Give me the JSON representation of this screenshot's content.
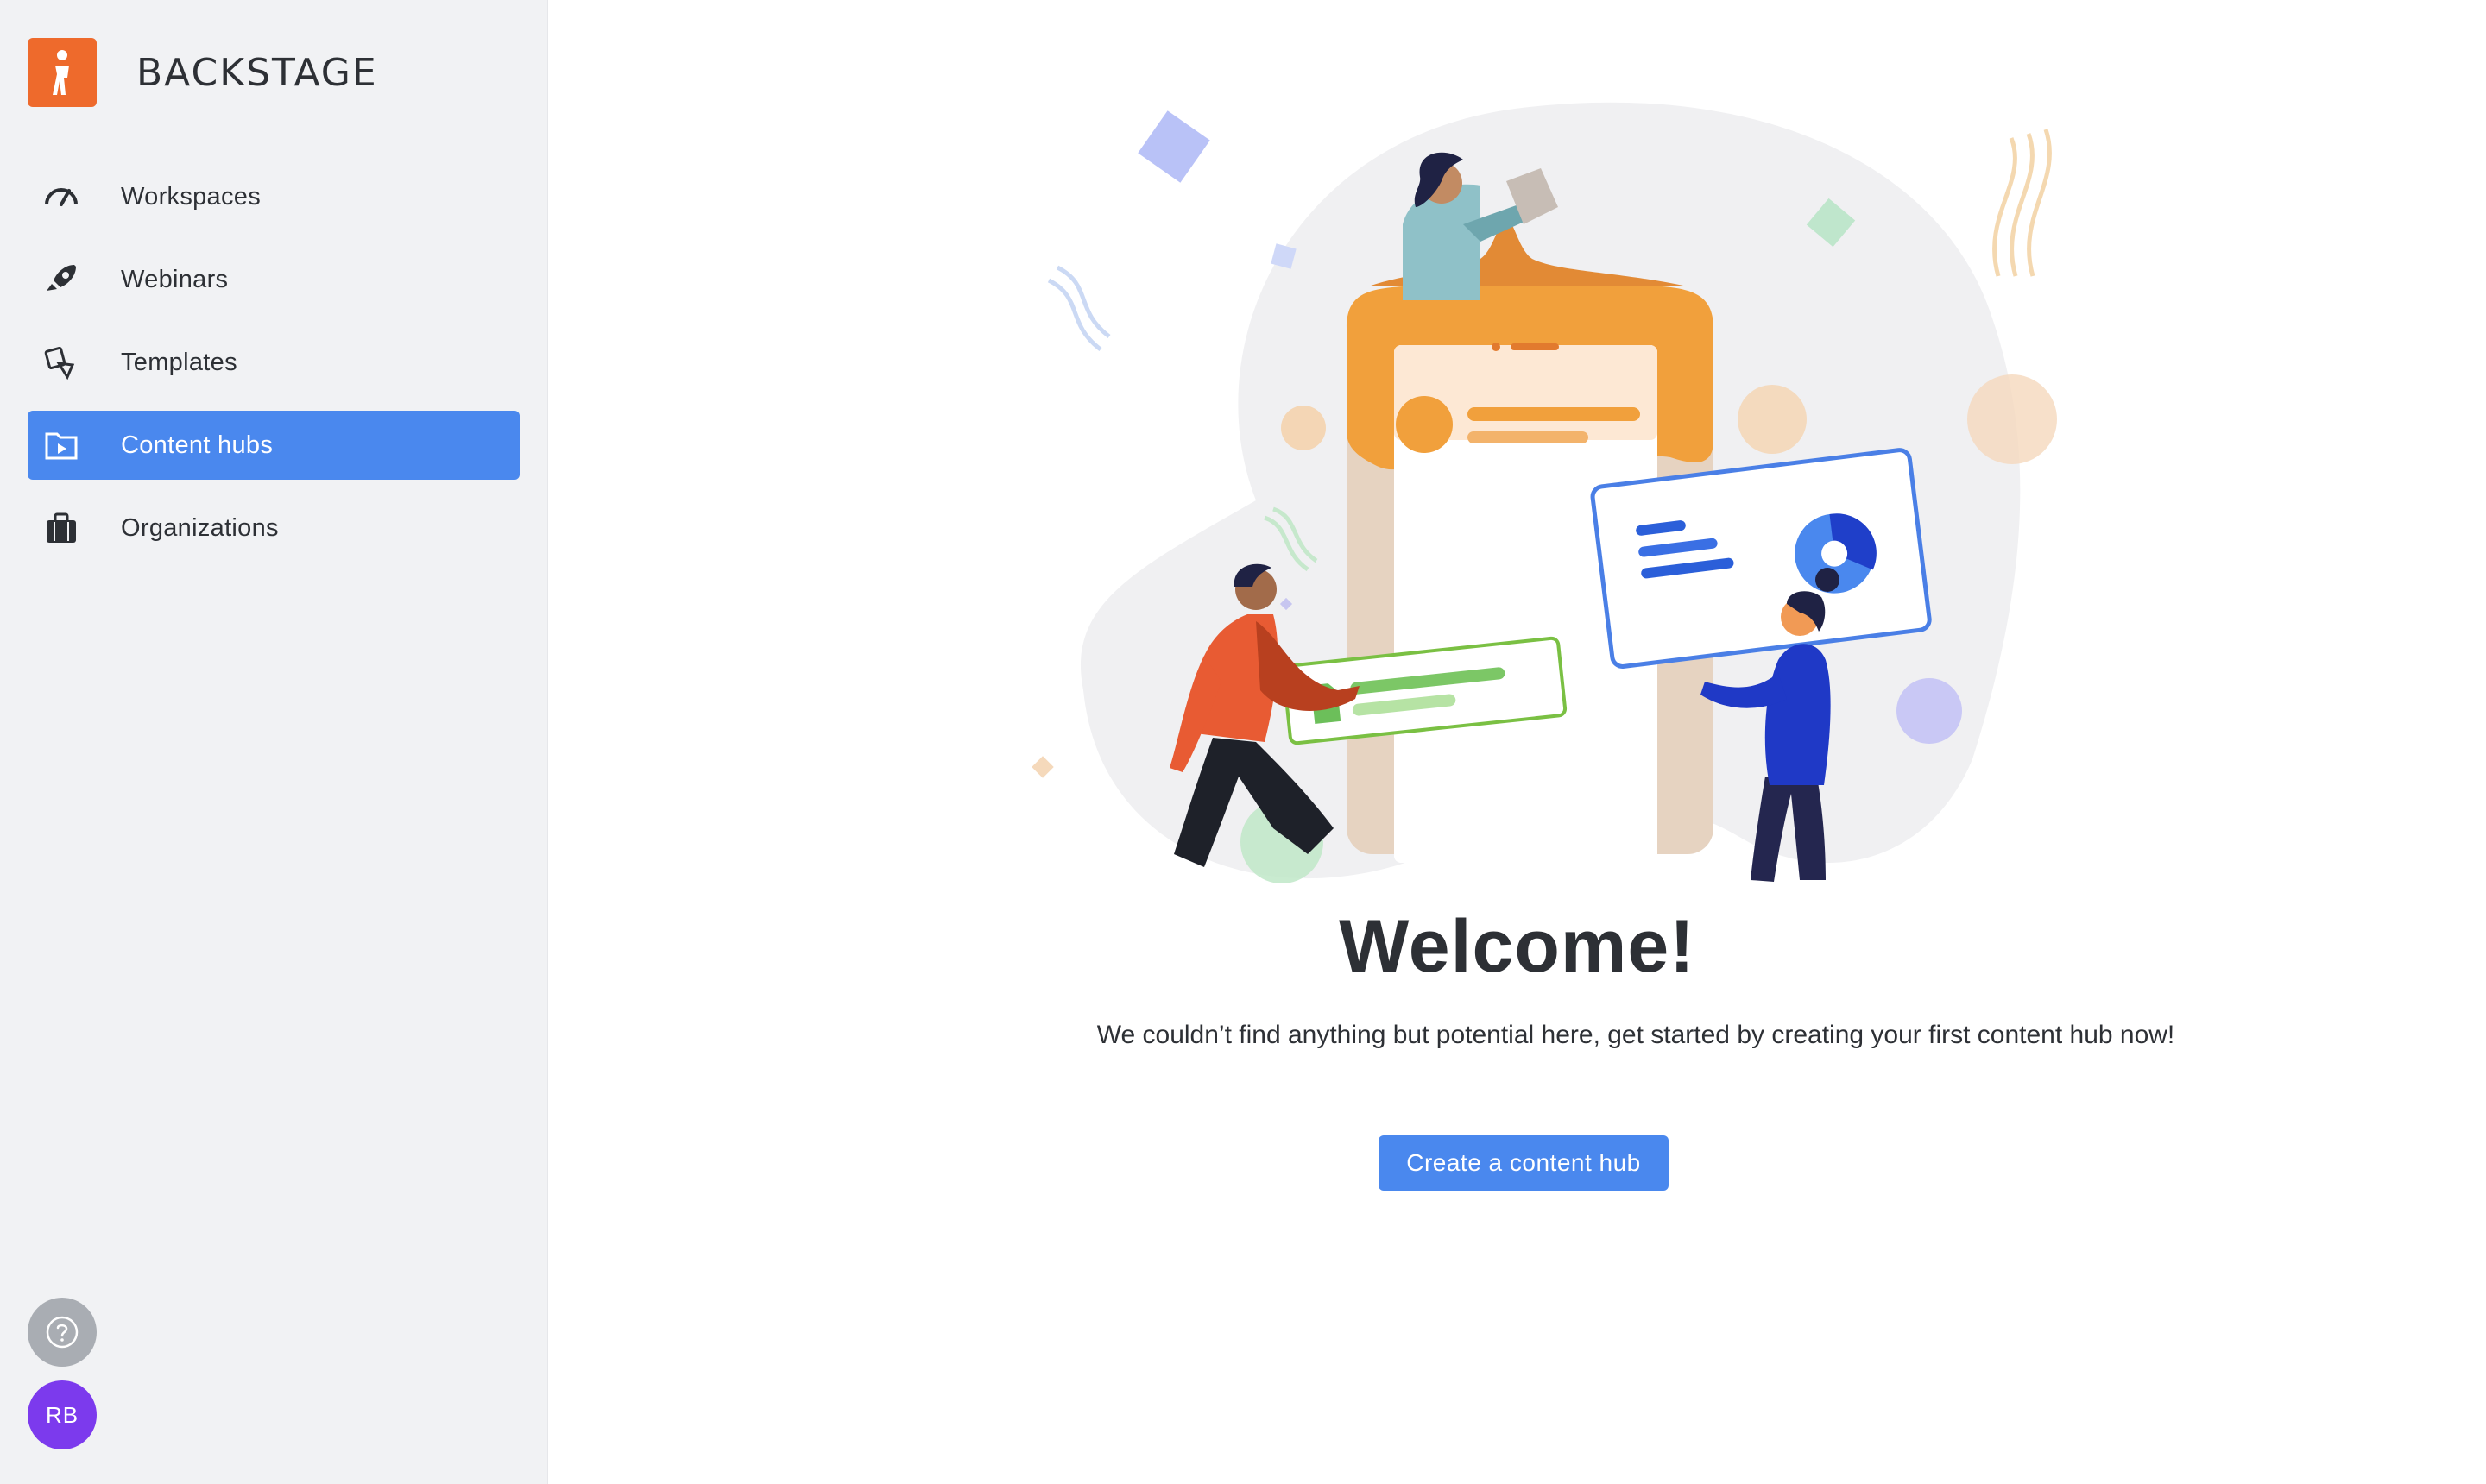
{
  "brand": {
    "name": "BACKSTAGE",
    "logo_icon": "person-walking-icon",
    "logo_color": "#ee6a2c"
  },
  "sidebar": {
    "items": [
      {
        "label": "Workspaces",
        "icon": "speedometer-icon",
        "active": false
      },
      {
        "label": "Webinars",
        "icon": "rocket-icon",
        "active": false
      },
      {
        "label": "Templates",
        "icon": "shapes-icon",
        "active": false
      },
      {
        "label": "Content hubs",
        "icon": "folder-play-icon",
        "active": true
      },
      {
        "label": "Organizations",
        "icon": "briefcase-icon",
        "active": false
      }
    ],
    "help_icon": "question-circle-icon",
    "avatar_initials": "RB"
  },
  "main": {
    "title": "Welcome!",
    "description": "We couldn’t find anything but potential here, get started  by creating your first content hub now!",
    "cta_label": "Create a content hub"
  },
  "colors": {
    "accent": "#4a88ee",
    "avatar": "#7c3aed",
    "sidebar_bg": "#f1f2f4"
  }
}
